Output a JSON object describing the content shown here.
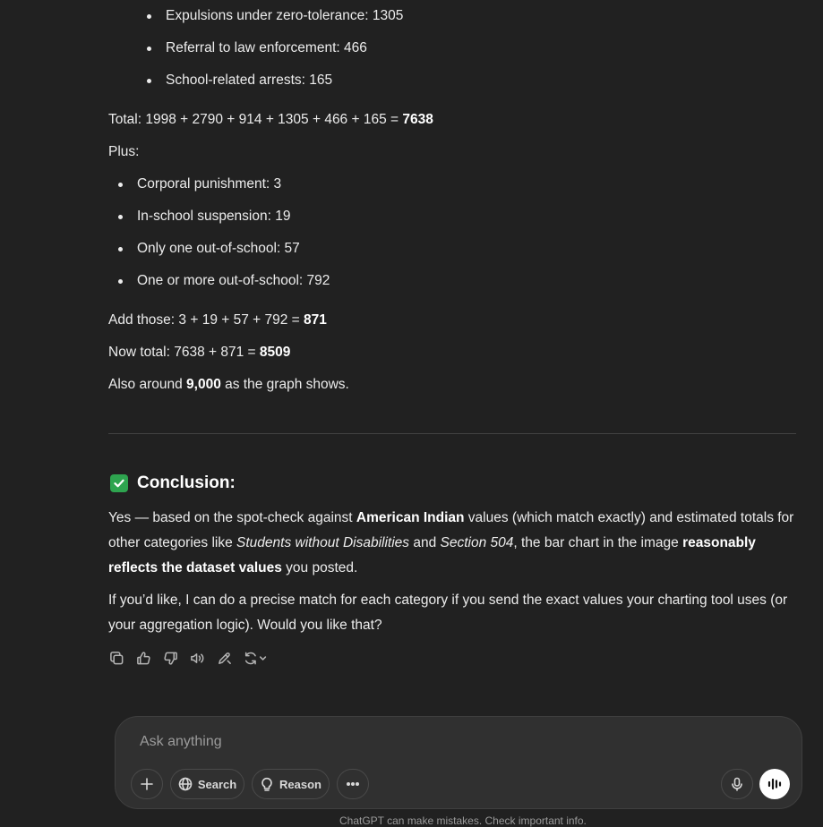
{
  "nested_list": [
    "Expulsions under zero-tolerance: 1305",
    "Referral to law enforcement: 466",
    "School-related arrests: 165"
  ],
  "total_line": {
    "text": "Total: 1998 + 2790 + 914 + 1305 + 466 + 165 = ",
    "value": "7638"
  },
  "plus_label": "Plus:",
  "plus_list": [
    "Corporal punishment: 3",
    "In-school suspension: 19",
    "Only one out-of-school: 57",
    "One or more out-of-school: 792"
  ],
  "add_line": {
    "text": "Add those: 3 + 19 + 57 + 792 = ",
    "value": "871"
  },
  "now_total_line": {
    "text": "Now total: 7638 + 871 = ",
    "value": "8509"
  },
  "also_line": {
    "prefix": "Also around ",
    "value": "9,000",
    "suffix": " as the graph shows."
  },
  "conclusion": {
    "title": "Conclusion:",
    "p1": {
      "a": "Yes — based on the spot-check against ",
      "b": "American Indian",
      "c": " values (which match exactly) and estimated totals for other categories like ",
      "d": "Students without Disabilities",
      "e": " and ",
      "f": "Section 504",
      "g": ", the bar chart in the image ",
      "h": "reasonably reflects the dataset values",
      "i": " you posted."
    },
    "p2": "If you’d like, I can do a precise match for each category if you send the exact values your charting tool uses (or your aggregation logic). Would you like that?"
  },
  "composer": {
    "placeholder": "Ask anything",
    "search_label": "Search",
    "reason_label": "Reason"
  },
  "footer": "ChatGPT can make mistakes. Check important info."
}
